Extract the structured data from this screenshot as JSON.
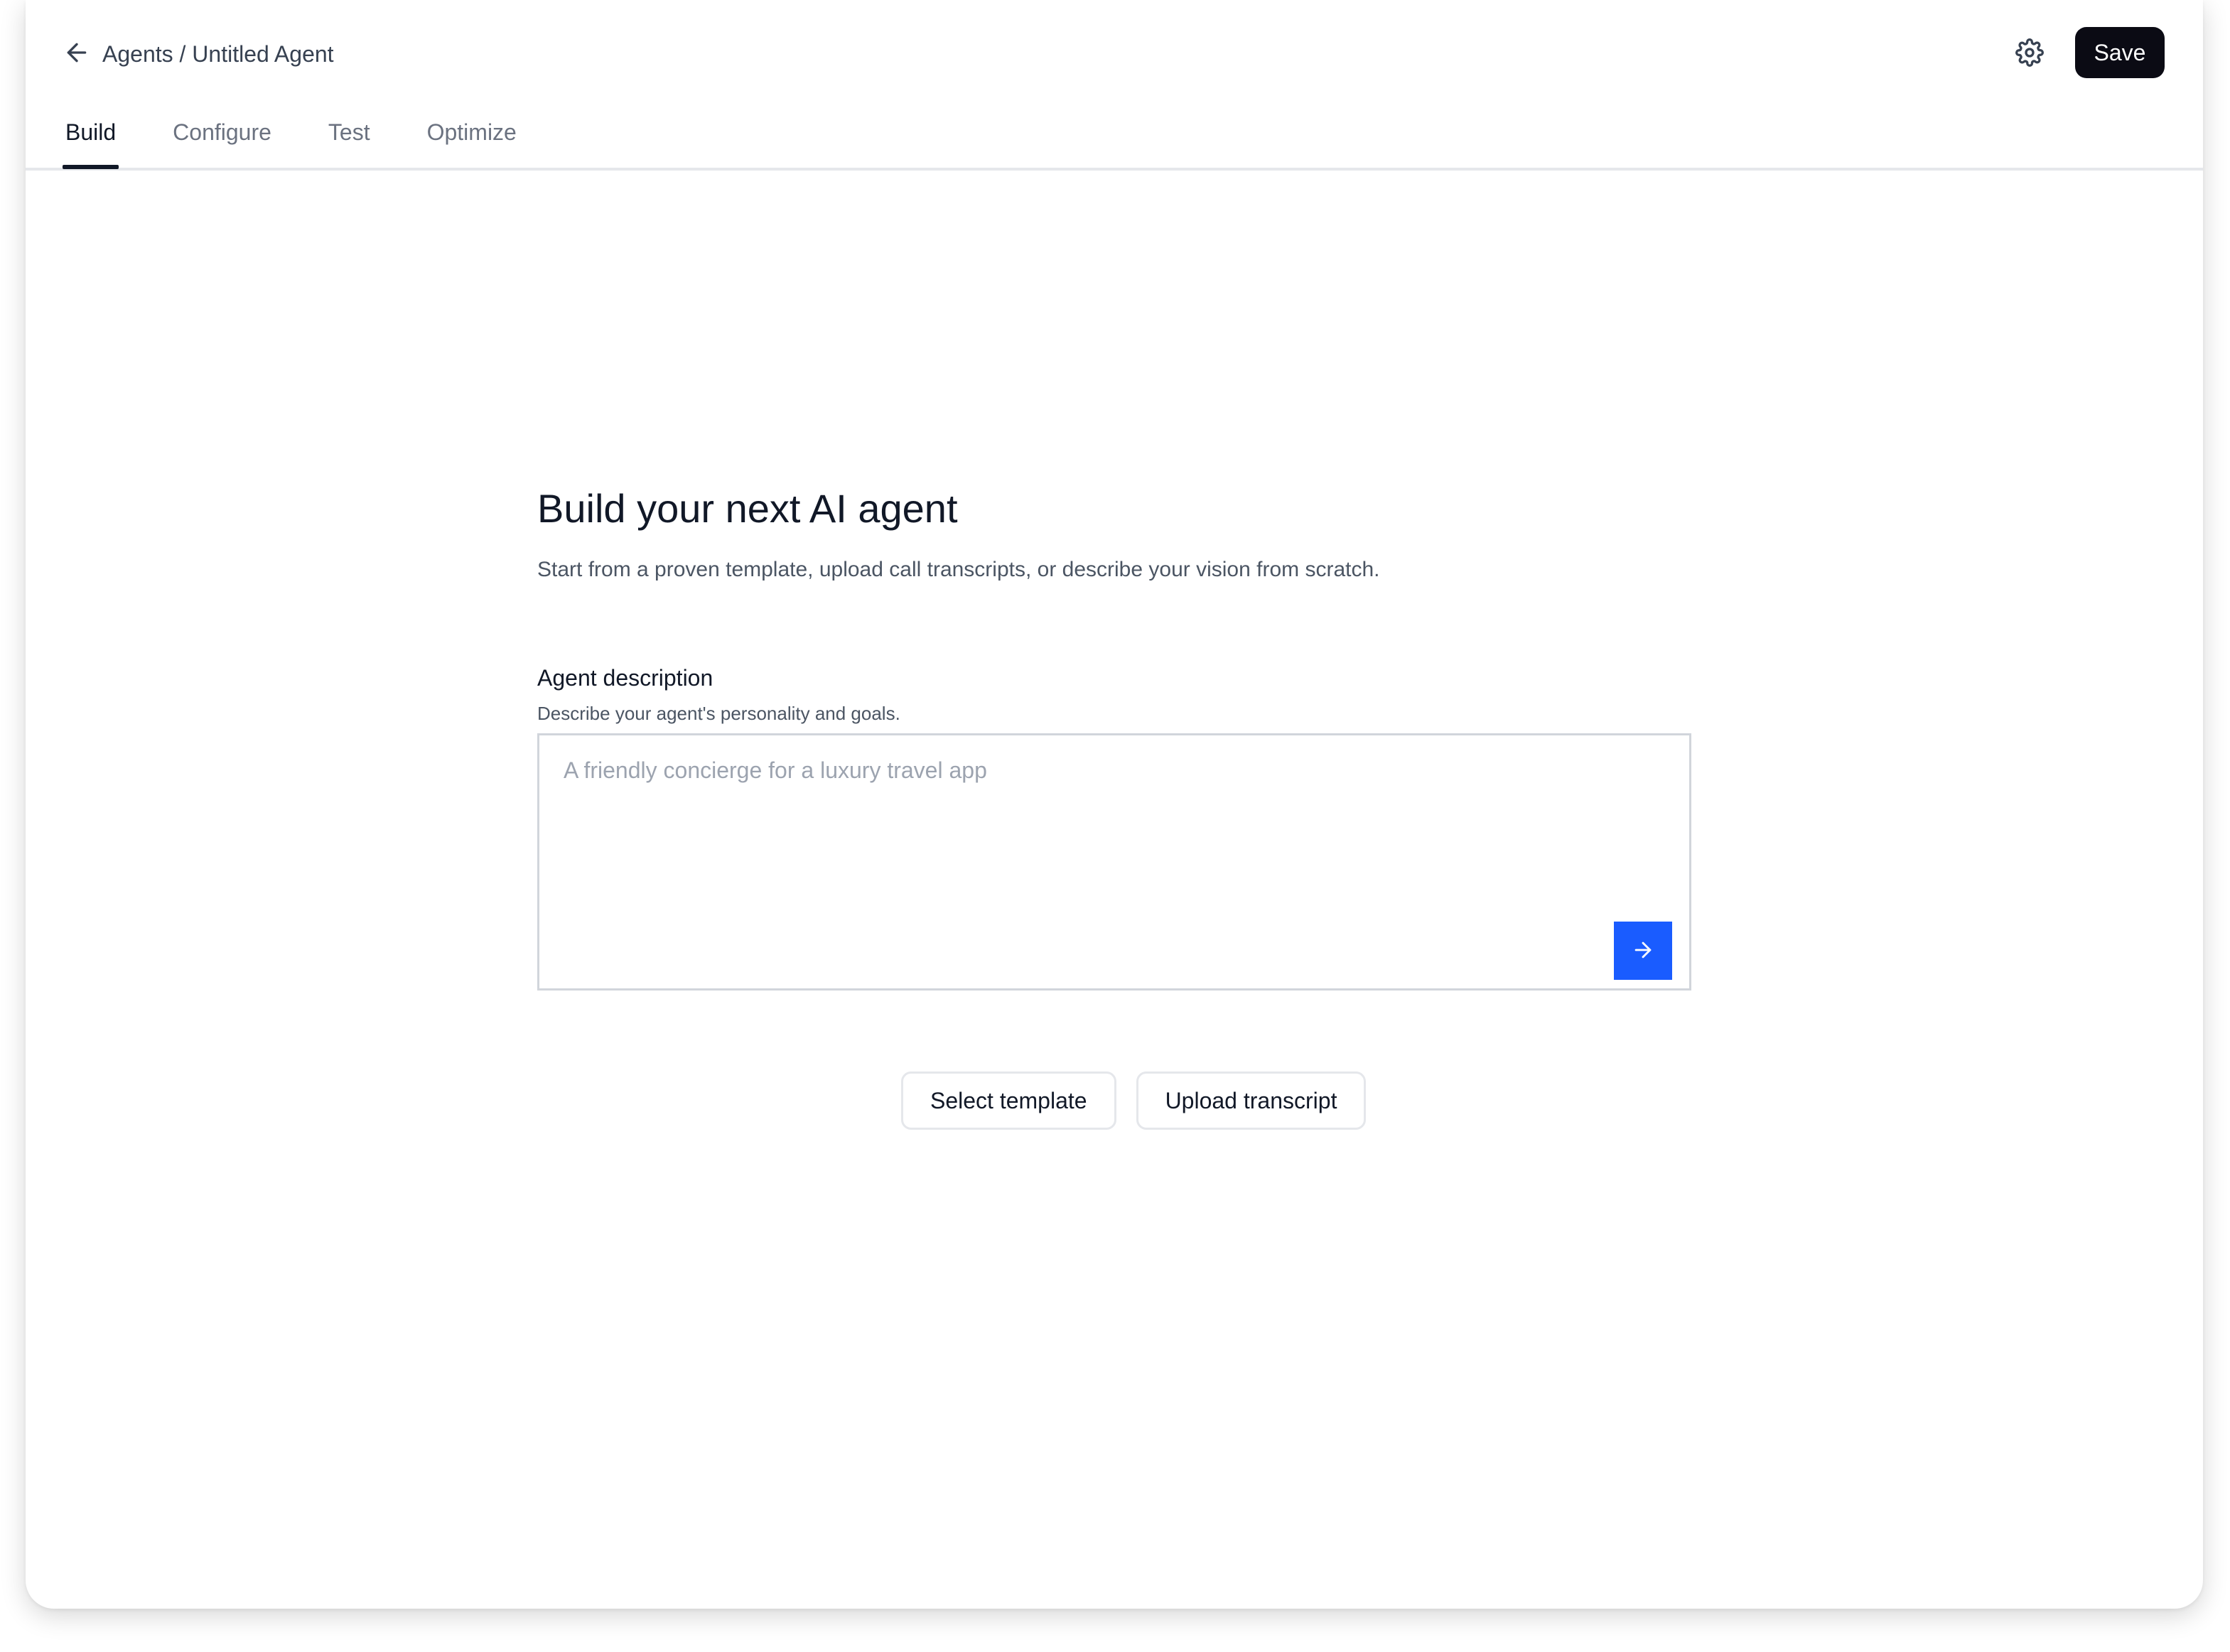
{
  "header": {
    "breadcrumb": "Agents / Untitled Agent",
    "back_icon": "arrow-left-icon",
    "settings_icon": "gear-icon",
    "save_label": "Save"
  },
  "tabs": [
    {
      "label": "Build",
      "active": true
    },
    {
      "label": "Configure",
      "active": false
    },
    {
      "label": "Test",
      "active": false
    },
    {
      "label": "Optimize",
      "active": false
    }
  ],
  "main": {
    "title": "Build your next AI agent",
    "subtitle": "Start from a proven template, upload call transcripts, or describe your vision from scratch.",
    "field_label": "Agent description",
    "field_help": "Describe your agent's personality and goals.",
    "description_value": "",
    "description_placeholder": "A friendly concierge for a luxury travel app",
    "submit_icon": "arrow-right-icon"
  },
  "actions": {
    "select_template": "Select template",
    "upload_transcript": "Upload transcript"
  },
  "colors": {
    "primary_dark": "#0b0b14",
    "accent_blue": "#1a5cff",
    "border": "#d1d5db",
    "muted_text": "#6b7280"
  }
}
